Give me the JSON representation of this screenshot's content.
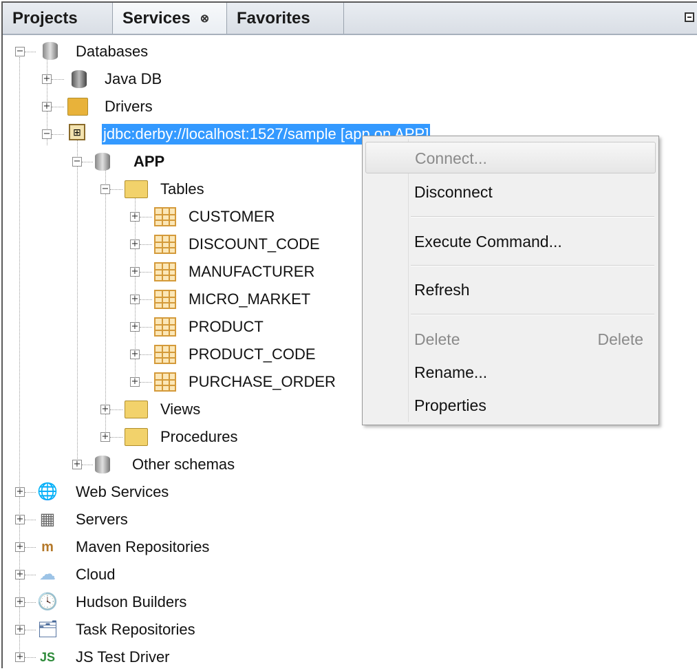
{
  "tabs": [
    {
      "label": "Projects"
    },
    {
      "label": "Services",
      "close": "⊗"
    },
    {
      "label": "Favorites"
    }
  ],
  "tree": {
    "databases": "Databases",
    "java_db": "Java DB",
    "drivers": "Drivers",
    "connection": "jdbc:derby://localhost:1527/sample [app on APP]",
    "app": "APP",
    "tables": "Tables",
    "table_items": [
      "CUSTOMER",
      "DISCOUNT_CODE",
      "MANUFACTURER",
      "MICRO_MARKET",
      "PRODUCT",
      "PRODUCT_CODE",
      "PURCHASE_ORDER"
    ],
    "views": "Views",
    "procedures": "Procedures",
    "other_schemas": "Other schemas",
    "web_services": "Web Services",
    "servers": "Servers",
    "maven": "Maven Repositories",
    "cloud": "Cloud",
    "hudson": "Hudson Builders",
    "task_repos": "Task Repositories",
    "js_test": "JS Test Driver"
  },
  "context_menu": {
    "connect": "Connect...",
    "disconnect": "Disconnect",
    "execute": "Execute Command...",
    "refresh": "Refresh",
    "delete": "Delete",
    "delete_shortcut": "Delete",
    "rename": "Rename...",
    "properties": "Properties"
  },
  "colors": {
    "selection": "#3399ff",
    "folder": "#f2d26b",
    "table_icon": "#d49a3a"
  },
  "icons": {
    "databases": "database-icon",
    "java_db": "java-db-icon",
    "drivers": "drivers-folder-icon",
    "connection": "connection-icon",
    "schema": "schema-icon",
    "folder": "folder-icon",
    "table": "table-icon",
    "web_services": "web-services-icon",
    "servers": "servers-icon",
    "maven": "maven-icon",
    "cloud": "cloud-icon",
    "hudson": "hudson-icon",
    "task_repos": "task-repository-icon",
    "js_test": "js-test-driver-icon"
  }
}
